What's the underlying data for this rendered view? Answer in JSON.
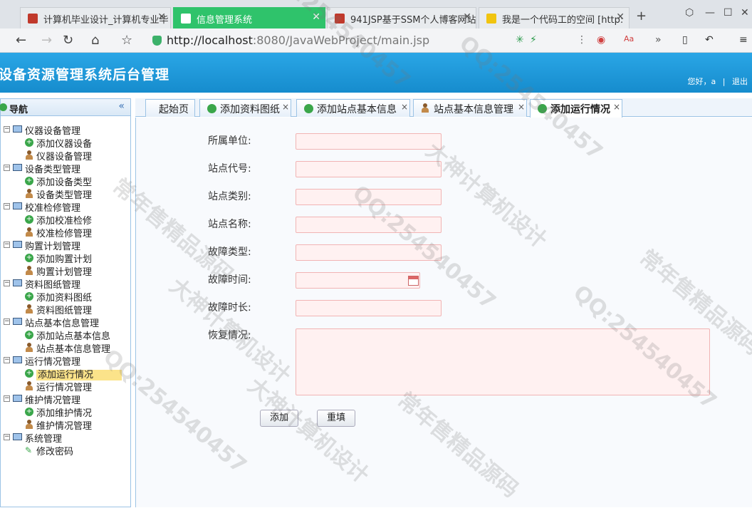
{
  "browser": {
    "tabs": [
      {
        "title": "计算机毕业设计_计算机专业毕",
        "favicon_color": "#c0392b"
      },
      {
        "title": "信息管理系统",
        "favicon_color": "#ffffff"
      },
      {
        "title": "941JSP基于SSM个人博客网站",
        "favicon_color": "#c0392b"
      },
      {
        "title": "我是一个代码工的空间 [http:",
        "favicon_color": "#f1c40f"
      }
    ],
    "active_tab_index": 1,
    "url_host": "http://localhost",
    "url_rest": ":8080/JavaWebProject/main.jsp"
  },
  "app": {
    "title": "设备资源管理系统后台管理",
    "greeting": "您好，a",
    "logout": "退出"
  },
  "sidebar": {
    "title": "导航",
    "groups": [
      {
        "label": "仪器设备管理",
        "items": [
          {
            "label": "添加仪器设备",
            "icon": "add-icon"
          },
          {
            "label": "仪器设备管理",
            "icon": "user-icon"
          }
        ]
      },
      {
        "label": "设备类型管理",
        "items": [
          {
            "label": "添加设备类型",
            "icon": "add-icon"
          },
          {
            "label": "设备类型管理",
            "icon": "user-icon"
          }
        ]
      },
      {
        "label": "校准检修管理",
        "items": [
          {
            "label": "添加校准检修",
            "icon": "add-icon"
          },
          {
            "label": "校准检修管理",
            "icon": "user-icon"
          }
        ]
      },
      {
        "label": "购置计划管理",
        "items": [
          {
            "label": "添加购置计划",
            "icon": "add-icon"
          },
          {
            "label": "购置计划管理",
            "icon": "user-icon"
          }
        ]
      },
      {
        "label": "资料图纸管理",
        "items": [
          {
            "label": "添加资料图纸",
            "icon": "add-icon"
          },
          {
            "label": "资料图纸管理",
            "icon": "user-icon"
          }
        ]
      },
      {
        "label": "站点基本信息管理",
        "items": [
          {
            "label": "添加站点基本信息",
            "icon": "add-icon"
          },
          {
            "label": "站点基本信息管理",
            "icon": "user-icon"
          }
        ]
      },
      {
        "label": "运行情况管理",
        "items": [
          {
            "label": "添加运行情况",
            "icon": "add-icon"
          },
          {
            "label": "运行情况管理",
            "icon": "user-icon"
          }
        ]
      },
      {
        "label": "维护情况管理",
        "items": [
          {
            "label": "添加维护情况",
            "icon": "add-icon"
          },
          {
            "label": "维护情况管理",
            "icon": "user-icon"
          }
        ]
      },
      {
        "label": "系统管理",
        "items": [
          {
            "label": "修改密码",
            "icon": "pencil-icon"
          }
        ]
      }
    ],
    "selected": "添加运行情况"
  },
  "content_tabs": [
    {
      "label": "起始页",
      "icon": "none",
      "closable": false
    },
    {
      "label": "添加资料图纸",
      "icon": "add-icon",
      "closable": true
    },
    {
      "label": "添加站点基本信息",
      "icon": "add-icon",
      "closable": true
    },
    {
      "label": "站点基本信息管理",
      "icon": "user-icon",
      "closable": true
    },
    {
      "label": "添加运行情况",
      "icon": "add-icon",
      "closable": true
    }
  ],
  "form": {
    "fields": [
      {
        "label": "所属单位:",
        "value": ""
      },
      {
        "label": "站点代号:",
        "value": ""
      },
      {
        "label": "站点类别:",
        "value": ""
      },
      {
        "label": "站点名称:",
        "value": ""
      },
      {
        "label": "故障类型:",
        "value": ""
      },
      {
        "label": "故障时间:",
        "value": ""
      },
      {
        "label": "故障时长:",
        "value": ""
      },
      {
        "label": "恢复情况:",
        "value": ""
      }
    ],
    "submit_label": "添加",
    "reset_label": "重填"
  },
  "watermarks": [
    "QQ:254540457",
    "大神计算机设计",
    "常年售精品源码"
  ],
  "colors": {
    "header": "#1a96d6",
    "active_browser_tab": "#2fc36b",
    "input_bg": "#fff1f1",
    "selection": "#fbe38a"
  }
}
